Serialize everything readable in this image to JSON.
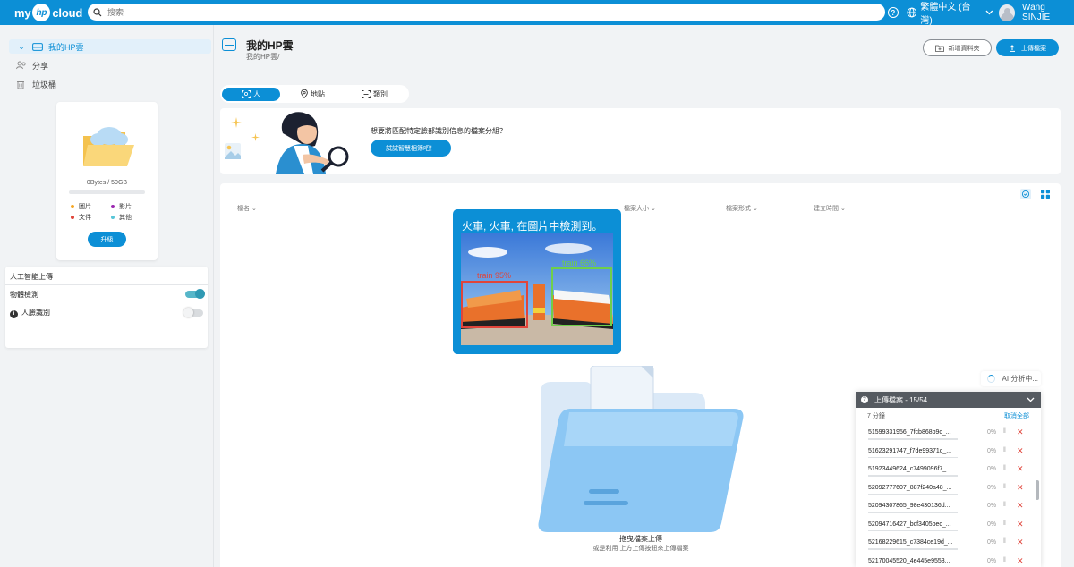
{
  "app": {
    "logo_prefix": "my",
    "logo_brand": "hp",
    "logo_suffix": "cloud"
  },
  "search": {
    "placeholder": "搜索"
  },
  "header": {
    "language": "繁體中文 (台灣)",
    "user_name": "Wang SINJIE"
  },
  "sidebar": {
    "items": [
      {
        "label": "我的HP雲",
        "icon": "cloud-drive-icon"
      },
      {
        "label": "分享",
        "icon": "share-users-icon"
      },
      {
        "label": "垃圾桶",
        "icon": "trash-icon"
      }
    ],
    "storage": {
      "used_text": "0Bytes / 50GB",
      "used_fraction": 0,
      "legend": [
        {
          "label": "圖片",
          "color": "#f5a623"
        },
        {
          "label": "影片",
          "color": "#9b27b0"
        },
        {
          "label": "文件",
          "color": "#e0453b"
        },
        {
          "label": "其他",
          "color": "#58c6d8"
        }
      ],
      "upgrade_label": "升級"
    },
    "ai_upload": {
      "title": "人工智能上傳",
      "object_detection": {
        "label": "物體檢測",
        "enabled": true
      },
      "face_recognition": {
        "label": "人臉識別",
        "enabled": false
      }
    }
  },
  "page": {
    "title": "我的HP雲",
    "breadcrumb": "我的HP雲/",
    "new_folder_label": "新增資料夾",
    "upload_label": "上傳檔案"
  },
  "tabs": [
    {
      "label": "人",
      "icon": "face-scan-icon",
      "active": true
    },
    {
      "label": "地點",
      "icon": "location-pin-icon",
      "active": false
    },
    {
      "label": "類別",
      "icon": "category-scan-icon",
      "active": false
    }
  ],
  "banner": {
    "text": "想要將匹配特定臉部識別信息的檔案分組？",
    "button_label": "試試智慧相簿吧！"
  },
  "table": {
    "columns": [
      "檔名",
      "檔案大小",
      "檔案形式",
      "建立時間"
    ]
  },
  "ai_popup": {
    "title": "火車, 火車, 在圖片中檢測到。",
    "detections": [
      {
        "label": "train 95%",
        "color": "#e0453b"
      },
      {
        "label": "train 66%",
        "color": "#6fcf4a"
      }
    ]
  },
  "dropzone": {
    "title": "拖曳檔案上傳",
    "subtitle": "或是利用 上方上傳按鈕來上傳檔案"
  },
  "analyzing": {
    "label": "AI 分析中..."
  },
  "upload_panel": {
    "title": "上傳檔案 - 15/54",
    "remaining": "7 分鐘",
    "cancel_all": "取消全部",
    "files": [
      {
        "name": "51599331956_7fcb868b9c_...",
        "progress": "0%"
      },
      {
        "name": "51623291747_f7de99371c_...",
        "progress": "0%"
      },
      {
        "name": "51923449624_c7499096f7_...",
        "progress": "0%"
      },
      {
        "name": "52092777607_887f240a48_...",
        "progress": "0%"
      },
      {
        "name": "52094307865_98e430136d...",
        "progress": "0%"
      },
      {
        "name": "52094716427_bcf3405bec_...",
        "progress": "0%"
      },
      {
        "name": "52168229615_c7384ce19d_...",
        "progress": "0%"
      },
      {
        "name": "52170045520_4e445e9553...",
        "progress": "0%"
      }
    ]
  }
}
